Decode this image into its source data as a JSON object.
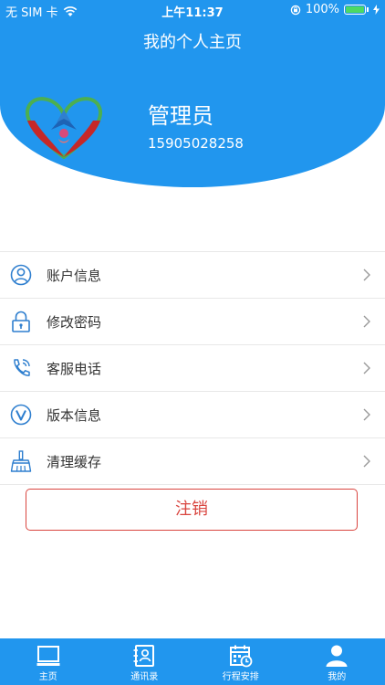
{
  "status_bar": {
    "carrier": "无 SIM 卡",
    "time": "上午11:37",
    "battery": "100%"
  },
  "header": {
    "title": "我的个人主页"
  },
  "profile": {
    "name": "管理员",
    "phone": "15905028258"
  },
  "menu": [
    {
      "label": "账户信息",
      "icon": "user-icon"
    },
    {
      "label": "修改密码",
      "icon": "lock-icon"
    },
    {
      "label": "客服电话",
      "icon": "phone-icon"
    },
    {
      "label": "版本信息",
      "icon": "version-icon"
    },
    {
      "label": "清理缓存",
      "icon": "broom-icon"
    }
  ],
  "logout_label": "注销",
  "tabbar": [
    {
      "label": "主页",
      "icon": "monitor-icon"
    },
    {
      "label": "通讯录",
      "icon": "contacts-icon"
    },
    {
      "label": "行程安排",
      "icon": "calendar-icon"
    },
    {
      "label": "我的",
      "icon": "person-icon"
    }
  ],
  "colors": {
    "primary": "#2196ee",
    "danger": "#d9453f",
    "battery": "#4cd964"
  }
}
